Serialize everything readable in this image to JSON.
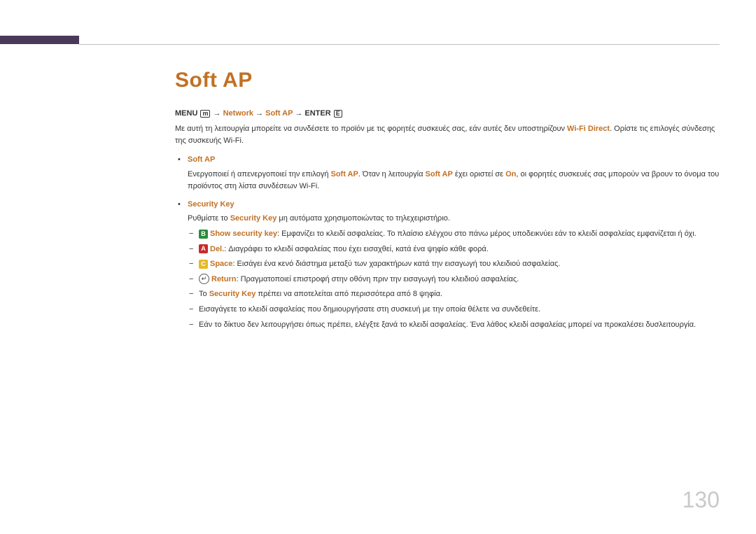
{
  "title": "Soft AP",
  "menu_path": {
    "prefix": "MENU",
    "menu_icon": "m",
    "arrow": "→",
    "network": "Network",
    "soft_ap": "Soft AP",
    "enter": "ENTER",
    "enter_icon": "E"
  },
  "intro": {
    "part1": "Με αυτή τη λειτουργία μπορείτε να συνδέσετε το προϊόν με τις φορητές συσκευές σας, εάν αυτές δεν υποστηρίζουν ",
    "wifi_direct": "Wi-Fi Direct",
    "part2": ". Ορίστε τις επιλογές σύνδεσης της συσκευής Wi-Fi."
  },
  "items": [
    {
      "title": "Soft AP",
      "body": {
        "p1": "Ενεργοποιεί ή απενεργοποιεί την επιλογή ",
        "hl1": "Soft AP",
        "p2": ". Όταν η λειτουργία ",
        "hl2": "Soft AP",
        "p3": " έχει οριστεί σε ",
        "hl3": "On",
        "p4": ", οι φορητές συσκευές σας μπορούν να βρουν το όνομα του προϊόντος στη λίστα συνδέσεων Wi-Fi."
      }
    },
    {
      "title": "Security Key",
      "lead": {
        "p1": "Ρυθμίστε το ",
        "hl1": "Security Key",
        "p2": " μη αυτόματα χρησιμοποιώντας το τηλεχειριστήριο."
      },
      "sub": [
        {
          "btn_type": "b",
          "btn_label": "B",
          "action": "Show security key",
          "text": ": Εμφανίζει το κλειδί ασφαλείας. Το πλαίσιο ελέγχου στο πάνω μέρος υποδεικνύει εάν το κλειδί ασφαλείας εμφανίζεται ή όχι."
        },
        {
          "btn_type": "a",
          "btn_label": "A",
          "action": "Del.",
          "text": ": Διαγράφει το κλειδί ασφαλείας που έχει εισαχθεί, κατά ένα ψηφίο κάθε φορά."
        },
        {
          "btn_type": "c",
          "btn_label": "C",
          "action": "Space",
          "text": ": Εισάγει ένα κενό διάστημα μεταξύ των χαρακτήρων κατά την εισαγωγή του κλειδιού ασφαλείας."
        },
        {
          "btn_type": "return",
          "btn_label": "↵",
          "action": "Return",
          "text": ": Πραγματοποιεί επιστροφή στην οθόνη πριν την εισαγωγή του κλειδιού ασφαλείας."
        },
        {
          "btn_type": "none",
          "pre": "Το ",
          "action": "Security Key",
          "text": " πρέπει να αποτελείται από περισσότερα από 8 ψηφία."
        },
        {
          "btn_type": "plain",
          "text": "Εισαγάγετε το κλειδί ασφαλείας που δημιουργήσατε στη συσκευή με την οποία θέλετε να συνδεθείτε."
        },
        {
          "btn_type": "plain",
          "text": "Εάν το δίκτυο δεν λειτουργήσει όπως πρέπει, ελέγξτε ξανά το κλειδί ασφαλείας. Ένα λάθος κλειδί ασφαλείας μπορεί να προκαλέσει δυσλειτουργία."
        }
      ]
    }
  ],
  "page_number": "130"
}
